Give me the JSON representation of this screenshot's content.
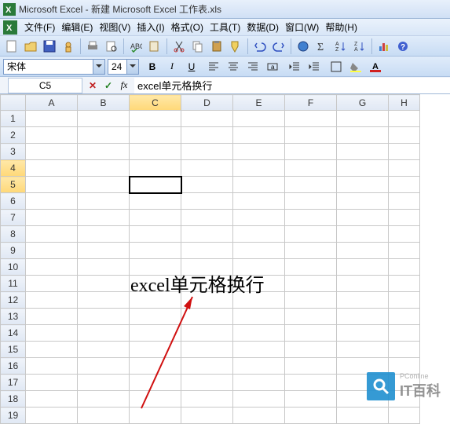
{
  "title": "Microsoft Excel - 新建 Microsoft Excel 工作表.xls",
  "menu": {
    "file": "文件(F)",
    "edit": "编辑(E)",
    "view": "视图(V)",
    "insert": "插入(I)",
    "format": "格式(O)",
    "tools": "工具(T)",
    "data": "数据(D)",
    "window": "窗口(W)",
    "help": "帮助(H)"
  },
  "format": {
    "font": "宋体",
    "size": "24"
  },
  "namebox": "C5",
  "formula": "excel单元格换行",
  "columns": [
    "A",
    "B",
    "C",
    "D",
    "E",
    "F",
    "G",
    "H"
  ],
  "rows": [
    "1",
    "2",
    "3",
    "4",
    "5",
    "6",
    "7",
    "8",
    "9",
    "10",
    "11",
    "12",
    "13",
    "14",
    "15",
    "16",
    "17",
    "18",
    "19"
  ],
  "cell_text": "excel单元格换行",
  "watermark": {
    "brand": "IT百科",
    "sub": "PConline"
  },
  "chart_data": null
}
